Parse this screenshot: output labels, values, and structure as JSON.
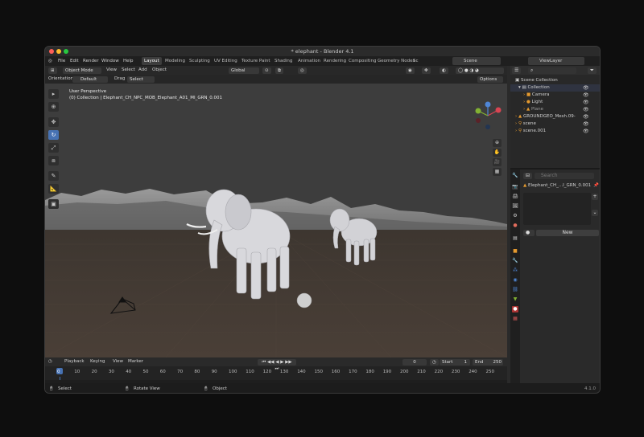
{
  "window": {
    "title": "* elephant - Blender 4.1"
  },
  "menu": {
    "items": [
      "File",
      "Edit",
      "Render",
      "Window",
      "Help"
    ],
    "workspaces": [
      "Layout",
      "Modeling",
      "Sculpting",
      "UV Editing",
      "Texture Paint",
      "Shading",
      "Animation",
      "Rendering",
      "Compositing",
      "Geometry Nodes",
      "Sc"
    ],
    "scene_label": "Scene",
    "viewlayer_label": "ViewLayer"
  },
  "viewport_header": {
    "mode": "Object Mode",
    "menus": [
      "View",
      "Select",
      "Add",
      "Object"
    ],
    "transform": "Global",
    "orientation_label": "Orientation:",
    "orientation_value": "Default",
    "drag_label": "Drag",
    "drag_value": "Select Box",
    "options": "Options"
  },
  "viewport": {
    "line1": "User Perspective",
    "line2": "(0) Collection | Elephant_CH_NPC_MOB_Elephant_A01_MI_GRN_0.001"
  },
  "outliner": {
    "root": "Scene Collection",
    "items": [
      {
        "name": "Collection"
      },
      {
        "name": "Camera"
      },
      {
        "name": "Light"
      },
      {
        "name": "Plane"
      },
      {
        "name": "GROUNDGEO_Mesh.09-"
      },
      {
        "name": "scene"
      },
      {
        "name": "scene.001"
      }
    ]
  },
  "properties": {
    "search_placeholder": "Search",
    "object_name": "Elephant_CH_...I_GRN_0.001",
    "new_button": "New"
  },
  "timeline": {
    "menus": [
      "Playback",
      "Keying",
      "View",
      "Marker"
    ],
    "current_frame": "0",
    "start_label": "Start",
    "start_value": "1",
    "end_label": "End",
    "end_value": "250",
    "frames": [
      "0",
      "10",
      "20",
      "30",
      "40",
      "50",
      "60",
      "70",
      "80",
      "90",
      "100",
      "110",
      "120",
      "130",
      "140",
      "150",
      "160",
      "170",
      "180",
      "190",
      "200",
      "210",
      "220",
      "230",
      "240",
      "250"
    ]
  },
  "status": {
    "select": "Select",
    "rotate": "Rotate View",
    "object": "Object",
    "version": "4.1.0"
  },
  "colors": {
    "accent": "#4772b3",
    "active_frame": "#4772b3",
    "header": "#282828"
  }
}
